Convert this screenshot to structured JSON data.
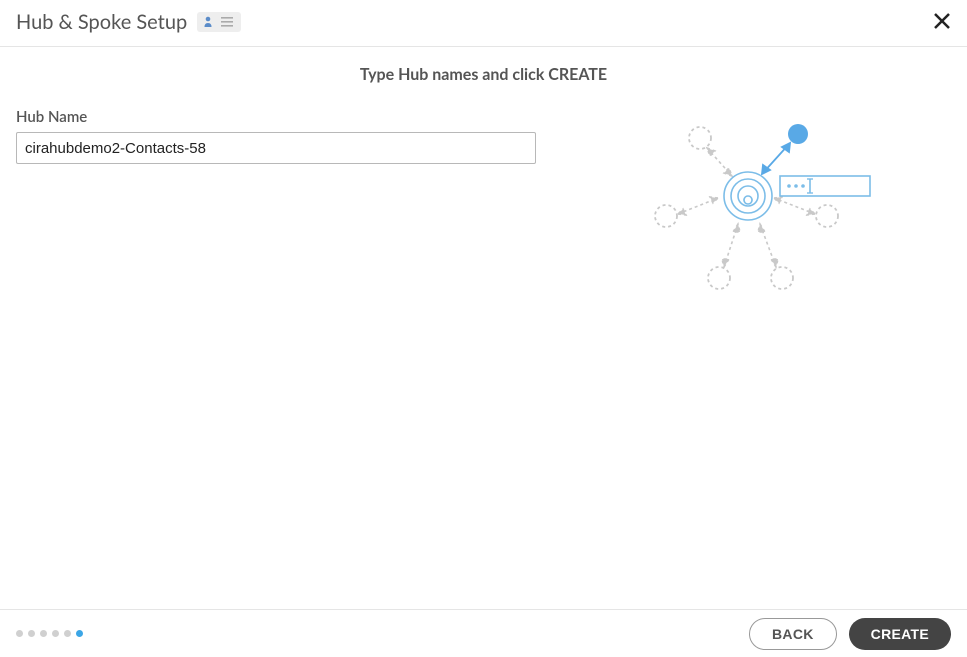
{
  "header": {
    "title": "Hub & Spoke Setup"
  },
  "subtitle": "Type Hub names and click CREATE",
  "form": {
    "hub_name_label": "Hub Name",
    "hub_name_value": "cirahubdemo2-Contacts-58"
  },
  "footer": {
    "back_label": "BACK",
    "create_label": "CREATE"
  },
  "progress": {
    "total": 6,
    "active_index": 5
  }
}
